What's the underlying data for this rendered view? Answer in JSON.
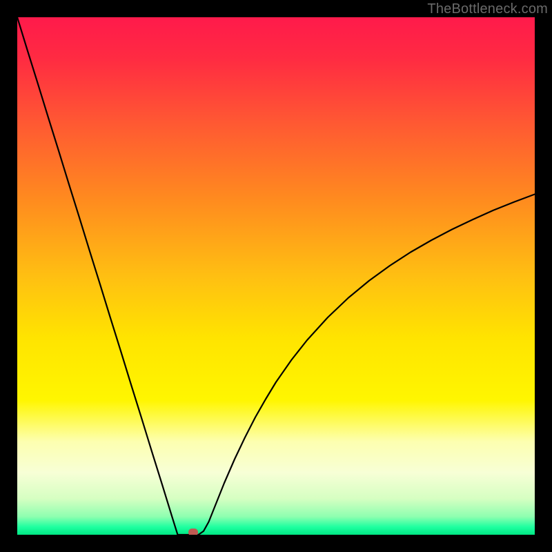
{
  "watermark": "TheBottleneck.com",
  "colors": {
    "background": "#000000",
    "curve": "#000000",
    "marker": "#bf5a52",
    "gradient_stops": [
      {
        "offset": 0.0,
        "color": "#ff1a4b"
      },
      {
        "offset": 0.08,
        "color": "#ff2b42"
      },
      {
        "offset": 0.2,
        "color": "#ff5733"
      },
      {
        "offset": 0.35,
        "color": "#ff8a1f"
      },
      {
        "offset": 0.5,
        "color": "#ffbf12"
      },
      {
        "offset": 0.62,
        "color": "#ffe400"
      },
      {
        "offset": 0.74,
        "color": "#fff600"
      },
      {
        "offset": 0.82,
        "color": "#fdffb0"
      },
      {
        "offset": 0.88,
        "color": "#f7ffd6"
      },
      {
        "offset": 0.93,
        "color": "#d6ffc2"
      },
      {
        "offset": 0.965,
        "color": "#8effb0"
      },
      {
        "offset": 0.985,
        "color": "#1effa0"
      },
      {
        "offset": 1.0,
        "color": "#00e884"
      }
    ]
  },
  "chart_data": {
    "type": "line",
    "title": "",
    "xlabel": "",
    "ylabel": "",
    "xlim": [
      0,
      100
    ],
    "ylim": [
      0,
      100
    ],
    "grid": false,
    "legend": false,
    "x": [
      0,
      2,
      4,
      6,
      8,
      10,
      12,
      14,
      16,
      18,
      20,
      22,
      24,
      26,
      28,
      30,
      31,
      32,
      33,
      34,
      35,
      36,
      37,
      38,
      40,
      42,
      44,
      46,
      48,
      50,
      53,
      56,
      60,
      64,
      68,
      72,
      76,
      80,
      84,
      88,
      92,
      96,
      100
    ],
    "values": [
      100,
      93.5,
      87.1,
      80.6,
      74.2,
      67.7,
      61.3,
      54.8,
      48.4,
      41.9,
      35.5,
      29.0,
      22.6,
      16.1,
      9.7,
      3.2,
      0.0,
      0.0,
      0.0,
      0.0,
      0.0,
      0.7,
      2.5,
      5.0,
      10.0,
      14.6,
      18.8,
      22.7,
      26.2,
      29.5,
      33.8,
      37.6,
      42.0,
      45.8,
      49.1,
      52.0,
      54.6,
      56.9,
      59.0,
      60.9,
      62.7,
      64.3,
      65.8
    ],
    "annotations": [
      {
        "name": "marker",
        "x": 34,
        "y": 0.5,
        "color": "#bf5a52"
      }
    ]
  }
}
